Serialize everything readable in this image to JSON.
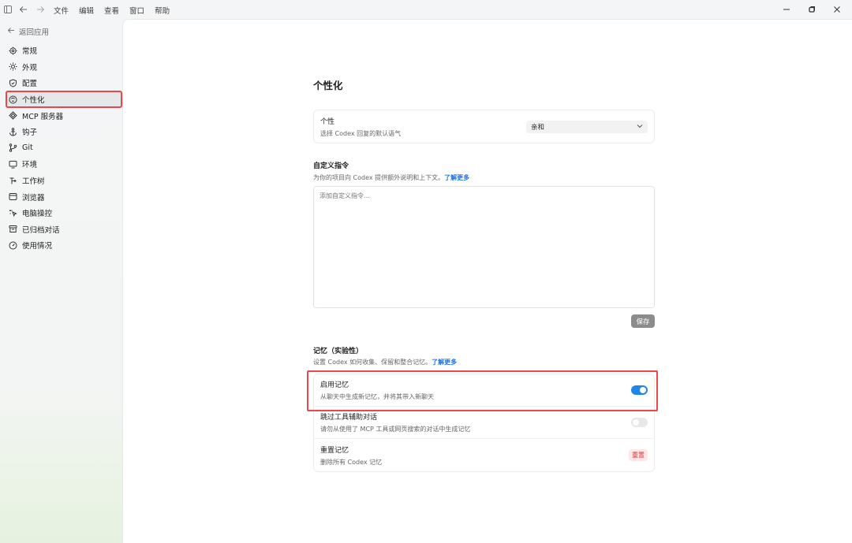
{
  "menu": [
    "文件",
    "编辑",
    "查看",
    "窗口",
    "帮助"
  ],
  "sidebar": {
    "back_label": "返回应用",
    "items": [
      {
        "label": "常规",
        "icon": "gear-icon"
      },
      {
        "label": "外观",
        "icon": "sun-icon"
      },
      {
        "label": "配置",
        "icon": "shield-icon"
      },
      {
        "label": "个性化",
        "icon": "persona-icon",
        "active": true
      },
      {
        "label": "MCP 服务器",
        "icon": "mcp-icon"
      },
      {
        "label": "钩子",
        "icon": "anchor-icon"
      },
      {
        "label": "Git",
        "icon": "git-branch-icon"
      },
      {
        "label": "环境",
        "icon": "monitor-icon"
      },
      {
        "label": "工作树",
        "icon": "worktree-icon"
      },
      {
        "label": "浏览器",
        "icon": "browser-icon"
      },
      {
        "label": "电脑操控",
        "icon": "pointer-icon"
      },
      {
        "label": "已归档对话",
        "icon": "archive-icon"
      },
      {
        "label": "使用情况",
        "icon": "gauge-icon"
      }
    ]
  },
  "main": {
    "title": "个性化",
    "personality": {
      "label": "个性",
      "desc": "选择 Codex 回复的默认语气",
      "value": "亲和"
    },
    "custom_instructions": {
      "title": "自定义指令",
      "desc": "为你的项目向 Codex 提供额外说明和上下文。",
      "learn_more": "了解更多",
      "placeholder": "添加自定义指令…",
      "save_label": "保存"
    },
    "memory": {
      "title": "记忆（实验性）",
      "desc": "设置 Codex 如何收集、保留和整合记忆。",
      "learn_more": "了解更多",
      "rows": [
        {
          "label": "启用记忆",
          "desc": "从聊天中生成新记忆，并将其带入新聊天",
          "toggle": "on"
        },
        {
          "label": "跳过工具辅助对话",
          "desc": "请勿从使用了 MCP 工具或网页搜索的对话中生成记忆",
          "toggle": "off"
        },
        {
          "label": "重置记忆",
          "desc": "删除所有 Codex 记忆",
          "button": "重置"
        }
      ]
    }
  },
  "colors": {
    "accent": "#1f86e8",
    "highlight": "#e8474b",
    "danger": "#d6393a"
  }
}
